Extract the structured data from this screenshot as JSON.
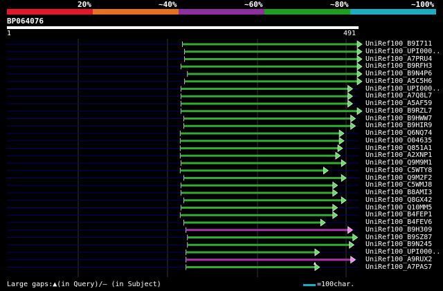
{
  "scale": {
    "labels": [
      "20%",
      "~40%",
      "~60%",
      "~80%",
      "~100%"
    ],
    "colors": [
      "#e3162a",
      "#e8701e",
      "#8e2fa0",
      "#1d9e1d",
      "#1aaec3"
    ]
  },
  "query": {
    "title": "BP064076",
    "start_label": "1",
    "end_label": "491",
    "length": 491
  },
  "alignment_colors": {
    "line": "#000066",
    "hit_default": "#33aa33",
    "hit_alt": "#aa33aa",
    "arrow": "#66dd66",
    "arrow_alt": "#ee88ee"
  },
  "hits": [
    {
      "label": "UniRef100_B9I711",
      "start": 245,
      "end": 512,
      "color": "green"
    },
    {
      "label": "UniRef100_UPI000..",
      "start": 248,
      "end": 512,
      "color": "green"
    },
    {
      "label": "UniRef100_A7PRU4",
      "start": 248,
      "end": 512,
      "color": "green"
    },
    {
      "label": "UniRef100_B9RFH3",
      "start": 243,
      "end": 512,
      "color": "green"
    },
    {
      "label": "UniRef100_B9N4P6",
      "start": 252,
      "end": 510,
      "color": "green"
    },
    {
      "label": "UniRef100_A5C5H6",
      "start": 248,
      "end": 512,
      "color": "green"
    },
    {
      "label": "UniRef100_UPI000..",
      "start": 243,
      "end": 476,
      "color": "green"
    },
    {
      "label": "UniRef100_A7Q8L7",
      "start": 243,
      "end": 476,
      "color": "green"
    },
    {
      "label": "UniRef100_A5AF59",
      "start": 243,
      "end": 476,
      "color": "green"
    },
    {
      "label": "UniRef100_B9RZL7",
      "start": 243,
      "end": 510,
      "color": "green"
    },
    {
      "label": "UniRef100_B9HWW7",
      "start": 247,
      "end": 480,
      "color": "green"
    },
    {
      "label": "UniRef100_B9HIR9",
      "start": 247,
      "end": 480,
      "color": "green"
    },
    {
      "label": "UniRef100_Q6NQ74",
      "start": 242,
      "end": 464,
      "color": "green"
    },
    {
      "label": "UniRef100_O04635",
      "start": 242,
      "end": 464,
      "color": "green"
    },
    {
      "label": "UniRef100_Q851A1",
      "start": 242,
      "end": 462,
      "color": "green"
    },
    {
      "label": "UniRef100_A2XNP1",
      "start": 242,
      "end": 459,
      "color": "green"
    },
    {
      "label": "UniRef100_Q9M9M1",
      "start": 243,
      "end": 467,
      "color": "green"
    },
    {
      "label": "UniRef100_C5WTY8",
      "start": 242,
      "end": 442,
      "color": "green"
    },
    {
      "label": "UniRef100_Q9M2F2",
      "start": 247,
      "end": 467,
      "color": "green"
    },
    {
      "label": "UniRef100_C5WMJ8",
      "start": 243,
      "end": 455,
      "color": "green"
    },
    {
      "label": "UniRef100_B8AMI3",
      "start": 243,
      "end": 455,
      "color": "green"
    },
    {
      "label": "UniRef100_Q8GX42",
      "start": 247,
      "end": 467,
      "color": "green"
    },
    {
      "label": "UniRef100_Q10MM5",
      "start": 243,
      "end": 455,
      "color": "green"
    },
    {
      "label": "UniRef100_B4FEP1",
      "start": 242,
      "end": 455,
      "color": "green"
    },
    {
      "label": "UniRef100_B4FEV6",
      "start": 247,
      "end": 438,
      "color": "green"
    },
    {
      "label": "UniRef100_B9H309",
      "start": 250,
      "end": 476,
      "color": "magenta"
    },
    {
      "label": "UniRef100_B9SZ87",
      "start": 252,
      "end": 483,
      "color": "green"
    },
    {
      "label": "UniRef100_B9N245",
      "start": 252,
      "end": 478,
      "color": "green"
    },
    {
      "label": "UniRef100_UPI000..",
      "start": 250,
      "end": 430,
      "color": "green"
    },
    {
      "label": "UniRef100_A9RUX2",
      "start": 250,
      "end": 480,
      "color": "magenta",
      "gap_marker": true
    },
    {
      "label": "UniRef100_A7PAS7",
      "start": 250,
      "end": 430,
      "color": "green"
    }
  ],
  "footer": {
    "large_gaps": "Large gaps:▲(in Query)/– (in Subject)",
    "legend_text": "=100char.",
    "legend_color": "#1aaec3"
  }
}
